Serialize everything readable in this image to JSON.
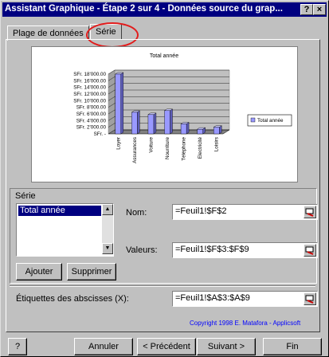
{
  "window": {
    "title": "Assistant Graphique - Étape 2 sur 4 - Données source du grap...",
    "help_button": "?",
    "close_button": "×"
  },
  "tabs": [
    {
      "label": "Plage de données",
      "active": false
    },
    {
      "label": "Série",
      "active": true
    }
  ],
  "chart_data": {
    "type": "bar",
    "title": "Total année",
    "categories": [
      "Loyer",
      "Assurances",
      "Voiture",
      "Nourriture",
      "Téléphone",
      "Electricité",
      "Loisirs"
    ],
    "series": [
      {
        "name": "Total année",
        "values": [
          18000,
          6500,
          5800,
          7000,
          3000,
          1400,
          2000
        ]
      }
    ],
    "y_tick_labels": [
      "SFr. 18'000.00",
      "SFr. 16'000.00",
      "SFr. 14'000.00",
      "SFr. 12'000.00",
      "SFr. 10'000.00",
      "SFr. 8'000.00",
      "SFr. 6'000.00",
      "SFr. 4'000.00",
      "SFr. 2'000.00",
      "SFr. -"
    ],
    "ylim": [
      0,
      18000
    ],
    "grid": true,
    "legend_position": "right",
    "bar_color": "#9999ff",
    "style": "3-D column"
  },
  "serie_group": {
    "label": "Série",
    "items": [
      "Total année"
    ],
    "selected_item": "Total année"
  },
  "buttons": {
    "add": "Ajouter",
    "remove": "Supprimer",
    "cancel": "Annuler",
    "previous": "< Précédent",
    "next": "Suivant >",
    "finish": "Fin",
    "help": "?"
  },
  "fields": {
    "name_label": "Nom:",
    "name_value": "=Feuil1!$F$2",
    "values_label": "Valeurs:",
    "values_value": "=Feuil1!$F$3:$F$9",
    "categories_label": "Étiquettes des abscisses (X):",
    "categories_value": "=Feuil1!$A$3:$A$9"
  },
  "copyright": "Copyright 1998 E. Matafora - Applicsoft",
  "annotation_color": "#e21b1b"
}
